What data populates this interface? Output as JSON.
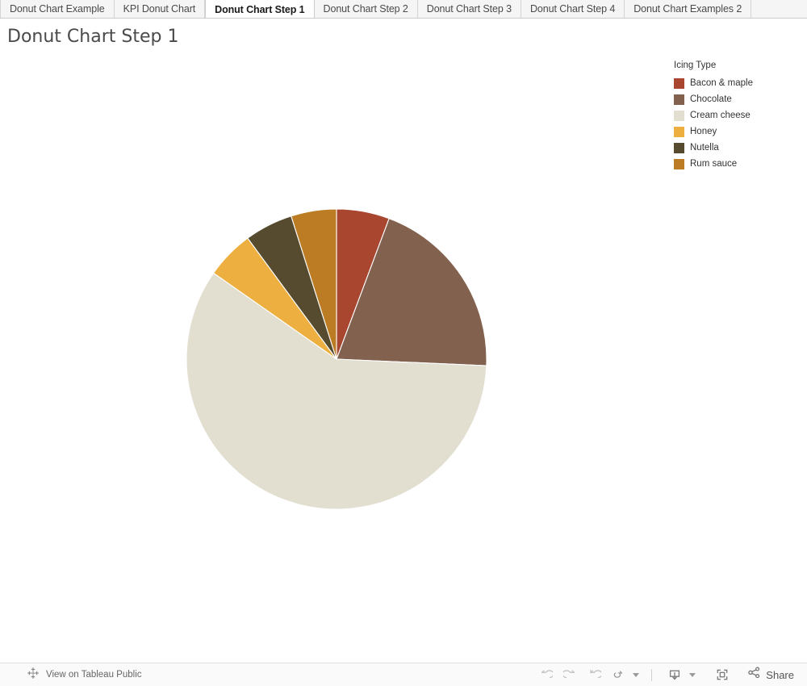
{
  "tabs": [
    {
      "label": "Donut Chart Example",
      "active": false
    },
    {
      "label": "KPI Donut Chart",
      "active": false
    },
    {
      "label": "Donut Chart Step 1",
      "active": true
    },
    {
      "label": "Donut Chart Step 2",
      "active": false
    },
    {
      "label": "Donut Chart Step 3",
      "active": false
    },
    {
      "label": "Donut Chart Step 4",
      "active": false
    },
    {
      "label": "Donut Chart Examples 2",
      "active": false
    }
  ],
  "viz": {
    "title": "Donut Chart Step 1"
  },
  "legend": {
    "title": "Icing Type",
    "items": [
      {
        "label": "Bacon & maple",
        "color": "#a9462f"
      },
      {
        "label": "Chocolate",
        "color": "#83614f"
      },
      {
        "label": "Cream cheese",
        "color": "#e2dfd1"
      },
      {
        "label": "Honey",
        "color": "#edaf40"
      },
      {
        "label": "Nutella",
        "color": "#574b2f"
      },
      {
        "label": "Rum sauce",
        "color": "#bb7c24"
      }
    ]
  },
  "chart_data": {
    "type": "pie",
    "title": "Donut Chart Step 1",
    "legend_title": "Icing Type",
    "legend_position": "right",
    "grid": false,
    "xlabel": "",
    "ylabel": "",
    "categories": [
      "Bacon & maple",
      "Chocolate",
      "Cream cheese",
      "Honey",
      "Nutella",
      "Rum sauce"
    ],
    "colors": [
      "#a9462f",
      "#83614f",
      "#e2dfd1",
      "#edaf40",
      "#574b2f",
      "#bb7c24"
    ],
    "values": [
      5.7,
      20.0,
      59.0,
      5.2,
      5.2,
      4.9
    ],
    "start_angle_deg": 0,
    "direction": "clockwise",
    "slices": [
      {
        "label": "Bacon & maple",
        "color": "#a9462f",
        "percent": 5.7,
        "start_deg": 0.0,
        "end_deg": 20.5
      },
      {
        "label": "Chocolate",
        "color": "#83614f",
        "percent": 20.0,
        "start_deg": 20.5,
        "end_deg": 92.5
      },
      {
        "label": "Cream cheese",
        "color": "#e2dfd1",
        "percent": 59.0,
        "start_deg": 92.5,
        "end_deg": 305.0
      },
      {
        "label": "Honey",
        "color": "#edaf40",
        "percent": 5.2,
        "start_deg": 305.0,
        "end_deg": 323.7
      },
      {
        "label": "Nutella",
        "color": "#574b2f",
        "percent": 5.2,
        "start_deg": 323.7,
        "end_deg": 342.4
      },
      {
        "label": "Rum sauce",
        "color": "#bb7c24",
        "percent": 4.9,
        "start_deg": 342.4,
        "end_deg": 360.0
      }
    ]
  },
  "toolbar": {
    "tableau_public_label": "View on Tableau Public",
    "share_label": "Share",
    "undo_label": "Undo",
    "redo_label": "Redo",
    "revert_label": "Revert",
    "refresh_label": "Refresh",
    "download_label": "Download",
    "fullscreen_label": "Full Screen"
  }
}
